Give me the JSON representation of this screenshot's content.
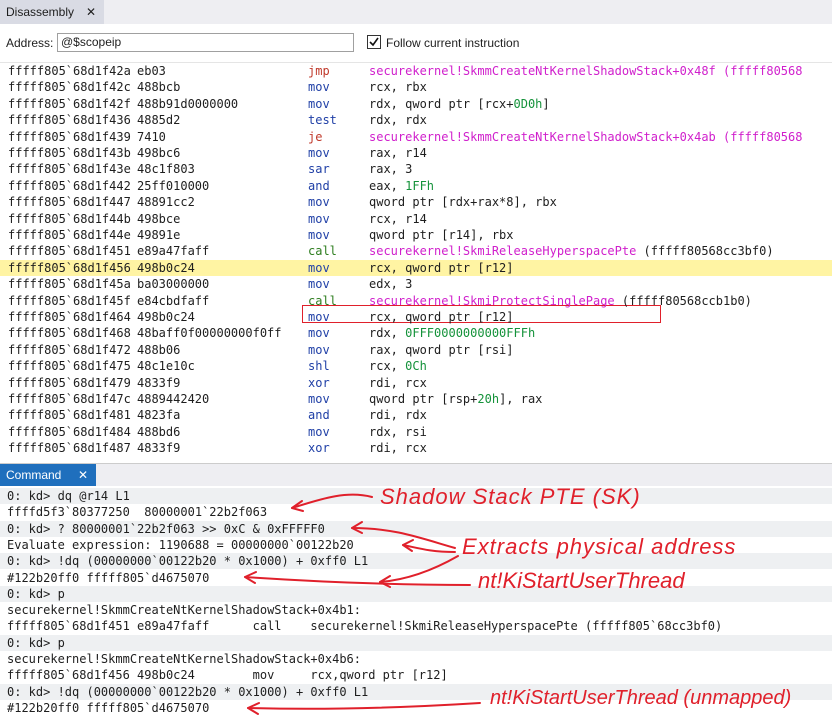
{
  "disassembly": {
    "tab_label": "Disassembly",
    "address_label": "Address:",
    "address_value": "@$scopeip",
    "follow_label": "Follow current instruction",
    "follow_checked": true,
    "rows": [
      {
        "addr": "fffff805`68d1f42a",
        "bytes": "eb03",
        "mn": "jmp",
        "ops": [
          {
            "t": "sym",
            "v": "securekernel!SkmmCreateNtKernelShadowStack+0x48f (fffff80568"
          }
        ]
      },
      {
        "addr": "fffff805`68d1f42c",
        "bytes": "488bcb",
        "mn": "mov",
        "ops": [
          {
            "t": "txt",
            "v": "rcx, rbx"
          }
        ]
      },
      {
        "addr": "fffff805`68d1f42f",
        "bytes": "488b91d0000000",
        "mn": "mov",
        "ops": [
          {
            "t": "txt",
            "v": "rdx, qword ptr [rcx+"
          },
          {
            "t": "num",
            "v": "0D0h"
          },
          {
            "t": "txt",
            "v": "]"
          }
        ]
      },
      {
        "addr": "fffff805`68d1f436",
        "bytes": "4885d2",
        "mn": "test",
        "ops": [
          {
            "t": "txt",
            "v": "rdx, rdx"
          }
        ]
      },
      {
        "addr": "fffff805`68d1f439",
        "bytes": "7410",
        "mn": "je",
        "ops": [
          {
            "t": "sym",
            "v": "securekernel!SkmmCreateNtKernelShadowStack+0x4ab (fffff80568"
          }
        ]
      },
      {
        "addr": "fffff805`68d1f43b",
        "bytes": "498bc6",
        "mn": "mov",
        "ops": [
          {
            "t": "txt",
            "v": "rax, r14"
          }
        ]
      },
      {
        "addr": "fffff805`68d1f43e",
        "bytes": "48c1f803",
        "mn": "sar",
        "ops": [
          {
            "t": "txt",
            "v": "rax, 3"
          }
        ]
      },
      {
        "addr": "fffff805`68d1f442",
        "bytes": "25ff010000",
        "mn": "and",
        "ops": [
          {
            "t": "txt",
            "v": "eax, "
          },
          {
            "t": "num",
            "v": "1FFh"
          }
        ]
      },
      {
        "addr": "fffff805`68d1f447",
        "bytes": "48891cc2",
        "mn": "mov",
        "ops": [
          {
            "t": "txt",
            "v": "qword ptr [rdx+rax*8], rbx"
          }
        ]
      },
      {
        "addr": "fffff805`68d1f44b",
        "bytes": "498bce",
        "mn": "mov",
        "ops": [
          {
            "t": "txt",
            "v": "rcx, r14"
          }
        ]
      },
      {
        "addr": "fffff805`68d1f44e",
        "bytes": "49891e",
        "mn": "mov",
        "ops": [
          {
            "t": "txt",
            "v": "qword ptr [r14], rbx"
          }
        ]
      },
      {
        "addr": "fffff805`68d1f451",
        "bytes": "e89a47faff",
        "mn": "call",
        "ops": [
          {
            "t": "sym",
            "v": "securekernel!SkmiReleaseHyperspacePte"
          },
          {
            "t": "txt",
            "v": " (fffff80568cc3bf0)"
          }
        ]
      },
      {
        "addr": "fffff805`68d1f456",
        "bytes": "498b0c24",
        "mn": "mov",
        "ops": [
          {
            "t": "txt",
            "v": "rcx, qword ptr [r12]"
          }
        ],
        "highlight": true
      },
      {
        "addr": "fffff805`68d1f45a",
        "bytes": "ba03000000",
        "mn": "mov",
        "ops": [
          {
            "t": "txt",
            "v": "edx, 3"
          }
        ]
      },
      {
        "addr": "fffff805`68d1f45f",
        "bytes": "e84cbdfaff",
        "mn": "call",
        "ops": [
          {
            "t": "sym",
            "v": "securekernel!SkmiProtectSinglePage"
          },
          {
            "t": "txt",
            "v": " (fffff80568ccb1b0)"
          }
        ]
      },
      {
        "addr": "fffff805`68d1f464",
        "bytes": "498b0c24",
        "mn": "mov",
        "ops": [
          {
            "t": "txt",
            "v": "rcx, qword ptr [r12]"
          }
        ]
      },
      {
        "addr": "fffff805`68d1f468",
        "bytes": "48baff0f00000000f0ff",
        "mn": "mov",
        "ops": [
          {
            "t": "txt",
            "v": "rdx, "
          },
          {
            "t": "num",
            "v": "0FFF0000000000FFFh"
          }
        ]
      },
      {
        "addr": "fffff805`68d1f472",
        "bytes": "488b06",
        "mn": "mov",
        "ops": [
          {
            "t": "txt",
            "v": "rax, qword ptr [rsi]"
          }
        ]
      },
      {
        "addr": "fffff805`68d1f475",
        "bytes": "48c1e10c",
        "mn": "shl",
        "ops": [
          {
            "t": "txt",
            "v": "rcx, "
          },
          {
            "t": "num",
            "v": "0Ch"
          }
        ]
      },
      {
        "addr": "fffff805`68d1f479",
        "bytes": "4833f9",
        "mn": "xor",
        "ops": [
          {
            "t": "txt",
            "v": "rdi, rcx"
          }
        ]
      },
      {
        "addr": "fffff805`68d1f47c",
        "bytes": "4889442420",
        "mn": "mov",
        "ops": [
          {
            "t": "txt",
            "v": "qword ptr [rsp+"
          },
          {
            "t": "num",
            "v": "20h"
          },
          {
            "t": "txt",
            "v": "], rax"
          }
        ]
      },
      {
        "addr": "fffff805`68d1f481",
        "bytes": "4823fa",
        "mn": "and",
        "ops": [
          {
            "t": "txt",
            "v": "rdi, rdx"
          }
        ]
      },
      {
        "addr": "fffff805`68d1f484",
        "bytes": "488bd6",
        "mn": "mov",
        "ops": [
          {
            "t": "txt",
            "v": "rdx, rsi"
          }
        ]
      },
      {
        "addr": "fffff805`68d1f487",
        "bytes": "4833f9",
        "mn": "xor",
        "ops": [
          {
            "t": "txt",
            "v": "rdi, rcx"
          }
        ]
      }
    ]
  },
  "command": {
    "tab_label": "Command",
    "lines": [
      "0: kd> dq @r14 L1",
      "ffffd5f3`80377250  80000001`22b2f063",
      "0: kd> ? 80000001`22b2f063 >> 0xC & 0xFFFFF0",
      "Evaluate expression: 1190688 = 00000000`00122b20",
      "0: kd> !dq (00000000`00122b20 * 0x1000) + 0xff0 L1",
      "#122b20ff0 fffff805`d4675070",
      "0: kd> p",
      "securekernel!SkmmCreateNtKernelShadowStack+0x4b1:",
      "fffff805`68d1f451 e89a47faff      call    securekernel!SkmiReleaseHyperspacePte (fffff805`68cc3bf0)",
      "0: kd> p",
      "securekernel!SkmmCreateNtKernelShadowStack+0x4b6:",
      "fffff805`68d1f456 498b0c24        mov     rcx,qword ptr [r12]",
      "0: kd> !dq (00000000`00122b20 * 0x1000) + 0xff0 L1",
      "#122b20ff0 fffff805`d4675070"
    ]
  },
  "annotations": {
    "shadow_pte": "Shadow Stack PTE (SK)",
    "extracts": "Extracts physical address",
    "start_thread": "nt!KiStartUserThread",
    "start_thread_unmapped": "nt!KiStartUserThread (unmapped)"
  },
  "colors": {
    "accent_blue": "#1f6fbd",
    "highlight": "#fff4a3",
    "annotation_red": "#e0202b",
    "symbol": "#d01fcc",
    "mnemonic": "#1f3fa6",
    "number": "#14923a"
  }
}
